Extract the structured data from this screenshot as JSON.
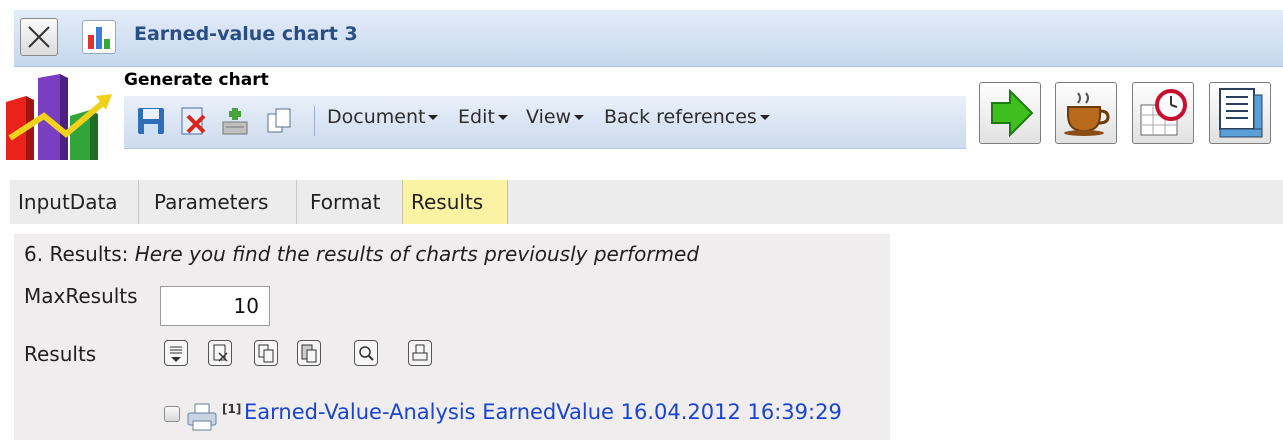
{
  "window": {
    "title": "Earned-value chart 3",
    "close_icon": "close-icon",
    "app_icon": "bar-chart-icon"
  },
  "header": {
    "title": "Generate chart",
    "logo": "chart-logo"
  },
  "toolbar": {
    "icons": [
      "save-icon",
      "delete-icon",
      "add-to-database-icon",
      "copy-icon"
    ],
    "menus": [
      {
        "label": "Document"
      },
      {
        "label": "Edit"
      },
      {
        "label": "View"
      },
      {
        "label": "Back references"
      }
    ],
    "action_buttons": [
      "run-arrow-icon",
      "coffee-cup-icon",
      "schedule-clock-icon",
      "ruler-sheet-icon"
    ],
    "accent_colors": {
      "run": "#3fbf1f",
      "title": "#2a4d84"
    }
  },
  "tabs": [
    {
      "label": "InputData",
      "active": false
    },
    {
      "label": "Parameters",
      "active": false
    },
    {
      "label": "Format",
      "active": false
    },
    {
      "label": "Results",
      "active": true
    }
  ],
  "results_panel": {
    "heading_prefix": "6. Results:",
    "heading_italic": "Here you find the results of charts previously performed",
    "max_results_label": "MaxResults",
    "max_results_value": "10",
    "results_label": "Results",
    "result_icons": [
      "align-bottom-icon",
      "delete-document-icon",
      "copy-document-icon",
      "paste-document-icon",
      "search-icon",
      "print-icon"
    ],
    "items": [
      {
        "footnote": "[1]",
        "text": "Earned-Value-Analysis EarnedValue 16.04.2012 16:39:29"
      }
    ]
  }
}
